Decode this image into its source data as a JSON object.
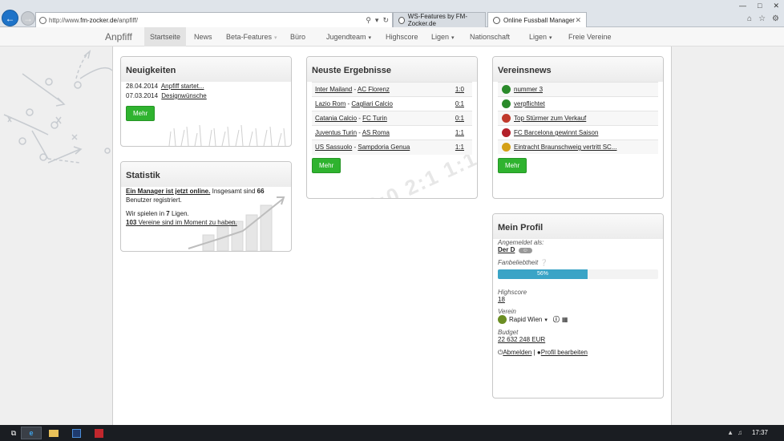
{
  "browser": {
    "url_prefix": "http://www.",
    "url_domain": "fm-zocker.de",
    "url_path": "/anpfiff/",
    "tabs": [
      {
        "label": "WS-Features by FM-Zocker.de"
      },
      {
        "label": "Online Fussball Manager"
      }
    ]
  },
  "nav": {
    "brand": "Anpfiff",
    "items": [
      {
        "label": "Startseite"
      },
      {
        "label": "News"
      },
      {
        "label": "Beta-Features"
      },
      {
        "label": "Büro"
      },
      {
        "label": "Jugendteam"
      },
      {
        "label": "Highscore"
      },
      {
        "label": "Ligen"
      },
      {
        "label": "Nationschaft"
      },
      {
        "label": "Ligen"
      },
      {
        "label": "Freie Vereine"
      }
    ]
  },
  "news": {
    "title": "Neuigkeiten",
    "items": [
      {
        "date": "28.04.2014",
        "text": "Anpfiff startet..."
      },
      {
        "date": "07.03.2014",
        "text": "Designwünsche"
      }
    ],
    "more": "Mehr"
  },
  "stats": {
    "title": "Statistik",
    "line1_link": "Ein Manager ist jetzt online.",
    "line1_a": "Insgesamt sind",
    "line1_count": "66",
    "line1_b": "Benutzer registriert.",
    "line2_a": "Wir spielen in",
    "line2_count": "7",
    "line2_b": "Ligen.",
    "line3_count": "103",
    "line3_text": "Vereine sind im Moment zu haben."
  },
  "results": {
    "title": "Neuste Ergebnisse",
    "rows": [
      {
        "home": "Inter Mailand",
        "away": "AC Florenz",
        "score": "1:0"
      },
      {
        "home": "Lazio Rom",
        "away": "Cagliari Calcio",
        "score": "0:1"
      },
      {
        "home": "Catania Calcio",
        "away": "FC Turin",
        "score": "0:1"
      },
      {
        "home": "Juventus Turin",
        "away": "AS Roma",
        "score": "1:1"
      },
      {
        "home": "US Sassuolo",
        "away": "Sampdoria Genua",
        "score": "1:1"
      }
    ],
    "more": "Mehr",
    "watermark": "3:0 2:1 1:1"
  },
  "club_news": {
    "title": "Vereinsnews",
    "items": [
      {
        "text": "nummer 3",
        "color": "#2a8a2a"
      },
      {
        "text": "verpflichtet",
        "color": "#2a8a2a"
      },
      {
        "text": "Top Stürmer zum Verkauf",
        "color": "#c0392b"
      },
      {
        "text": "FC Barcelona gewinnt Saison",
        "color": "#b3202a"
      },
      {
        "text": "Eintracht Braunschweig vertritt SC...",
        "color": "#d4a017"
      }
    ],
    "more": "Mehr"
  },
  "profile": {
    "title": "Mein Profil",
    "logged_in_label": "Angemeldet als:",
    "username": "Der D",
    "fan_label": "Fanbeliebtheit",
    "fan_percent": 56,
    "fan_text": "56%",
    "highscore_label": "Highscore",
    "highscore": "18",
    "club_label": "Verein",
    "club": "Rapid Wien",
    "budget_label": "Budget",
    "budget": "22 632 248 EUR",
    "logout": "Abmelden",
    "sep": "|",
    "edit": "Profil bearbeiten"
  },
  "taskbar": {
    "clock": "17:37"
  }
}
